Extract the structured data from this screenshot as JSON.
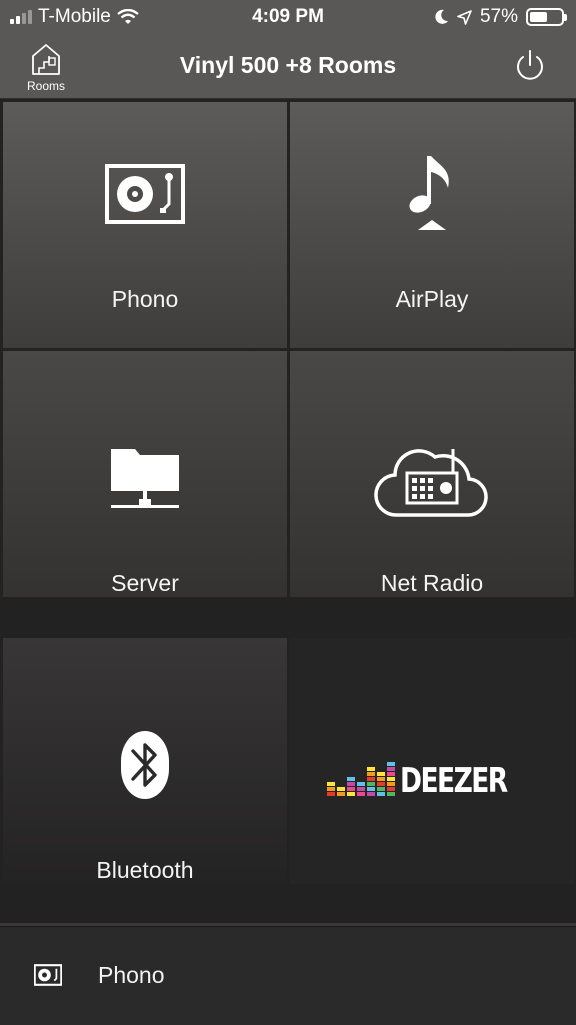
{
  "status": {
    "carrier": "T-Mobile",
    "time": "4:09 PM",
    "battery": "57%",
    "battery_level": 0.57
  },
  "nav": {
    "title": "Vinyl 500 +8 Rooms",
    "rooms_label": "Rooms"
  },
  "sources": [
    {
      "label": "Phono",
      "icon": "turntable-icon"
    },
    {
      "label": "AirPlay",
      "icon": "airplay-music-icon"
    },
    {
      "label": "Server",
      "icon": "server-folder-icon"
    },
    {
      "label": "Net Radio",
      "icon": "cloud-radio-icon"
    },
    {
      "label": "Bluetooth",
      "icon": "bluetooth-icon"
    },
    {
      "label": "DEEZER",
      "icon": "deezer-logo"
    }
  ],
  "now_playing": {
    "label": "Phono",
    "icon": "turntable-icon"
  },
  "colors": {
    "deezer_bars": [
      "#e53b2c",
      "#f59c1a",
      "#fce63a",
      "#e94a8c",
      "#c44ba5",
      "#5fc1e6",
      "#4fb75f"
    ]
  }
}
